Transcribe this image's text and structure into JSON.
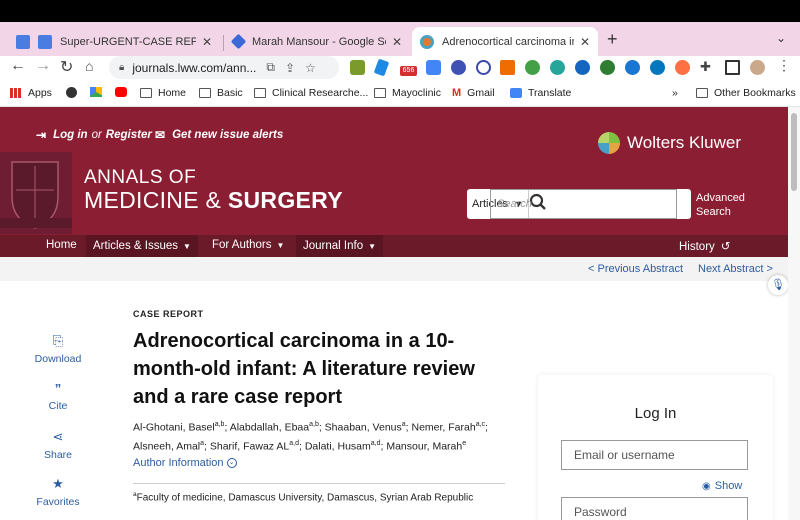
{
  "browser": {
    "tabs": [
      {
        "title": "Super-URGENT-CASE REPORT",
        "favicon_color": "#4a7de1"
      },
      {
        "title": "Marah Mansour - Google Schol",
        "favicon_color": "#3b6ad6"
      },
      {
        "title": "Adrenocortical carcinoma in a",
        "favicon_color": "#e07a2e",
        "active": true
      }
    ],
    "new_tab": "+",
    "address": {
      "url": "journals.lww.com/ann..."
    },
    "bookmarks": [
      {
        "label": "Apps",
        "icon": "apps-grid-icon"
      },
      {
        "label": "",
        "icon": "globe-icon"
      },
      {
        "label": "",
        "icon": "google-drive-icon"
      },
      {
        "label": "",
        "icon": "youtube-icon"
      },
      {
        "label": "Home",
        "icon": "folder-icon"
      },
      {
        "label": "Basic",
        "icon": "folder-icon"
      },
      {
        "label": "Clinical Researche...",
        "icon": "folder-icon"
      },
      {
        "label": "Mayoclinic",
        "icon": "folder-icon"
      },
      {
        "label": "Gmail",
        "icon": "gmail-icon"
      },
      {
        "label": "Translate",
        "icon": "translate-icon"
      }
    ],
    "more_bookmarks": "»",
    "other_bookmarks": "Other Bookmarks",
    "badge_count": "656"
  },
  "site": {
    "login_register_pre": "Log in",
    "login_register_or": "or",
    "login_register_post": "Register",
    "alerts": "Get new issue alerts",
    "publisher": "Wolters Kluwer",
    "journal_line1": "ANNALS OF",
    "journal_line2a": "MEDICINE & ",
    "journal_line2b": "SURGERY",
    "search_scope": "Articles",
    "search_placeholder": "Search",
    "advanced_search_1": "Advanced",
    "advanced_search_2": "Search",
    "nav": {
      "home": "Home",
      "articles": "Articles & Issues",
      "authors": "For Authors",
      "journal_info": "Journal Info",
      "history": "History"
    },
    "prev_abstract": "< Previous Abstract",
    "next_abstract": "Next Abstract >"
  },
  "sidebar_actions": {
    "download": "Download",
    "cite": "Cite",
    "share": "Share",
    "favorites": "Favorites"
  },
  "article": {
    "type": "CASE REPORT",
    "title": "Adrenocortical carcinoma in a 10-month-old infant: A literature review and a rare case report",
    "authors_line1": "Al-Ghotani, Basel",
    "authors_sup1": "a,b",
    "authors_line1b": "; Alabdallah, Ebaa",
    "authors_sup2": "a,b",
    "authors_line1c": "; Shaaban, Venus",
    "authors_sup3": "a",
    "authors_line1d": "; Nemer, Farah",
    "authors_sup4": "a,c",
    "authors_line2": "; Alsneeh, Amal",
    "authors_sup5": "a",
    "authors_line2b": "; Sharif, Fawaz AL",
    "authors_sup6": "a,d",
    "authors_line2c": "; Dalati, Husam",
    "authors_sup7": "a,d",
    "authors_line2d": "; Mansour, Marah",
    "authors_sup8": "e",
    "author_info": "Author Information",
    "affil_sup": "a",
    "affiliation": "Faculty of medicine, Damascus University, Damascus, Syrian Arab Republic"
  },
  "login": {
    "title": "Log In",
    "email_placeholder": "Email or username",
    "show": "Show",
    "password_placeholder": "Password"
  }
}
